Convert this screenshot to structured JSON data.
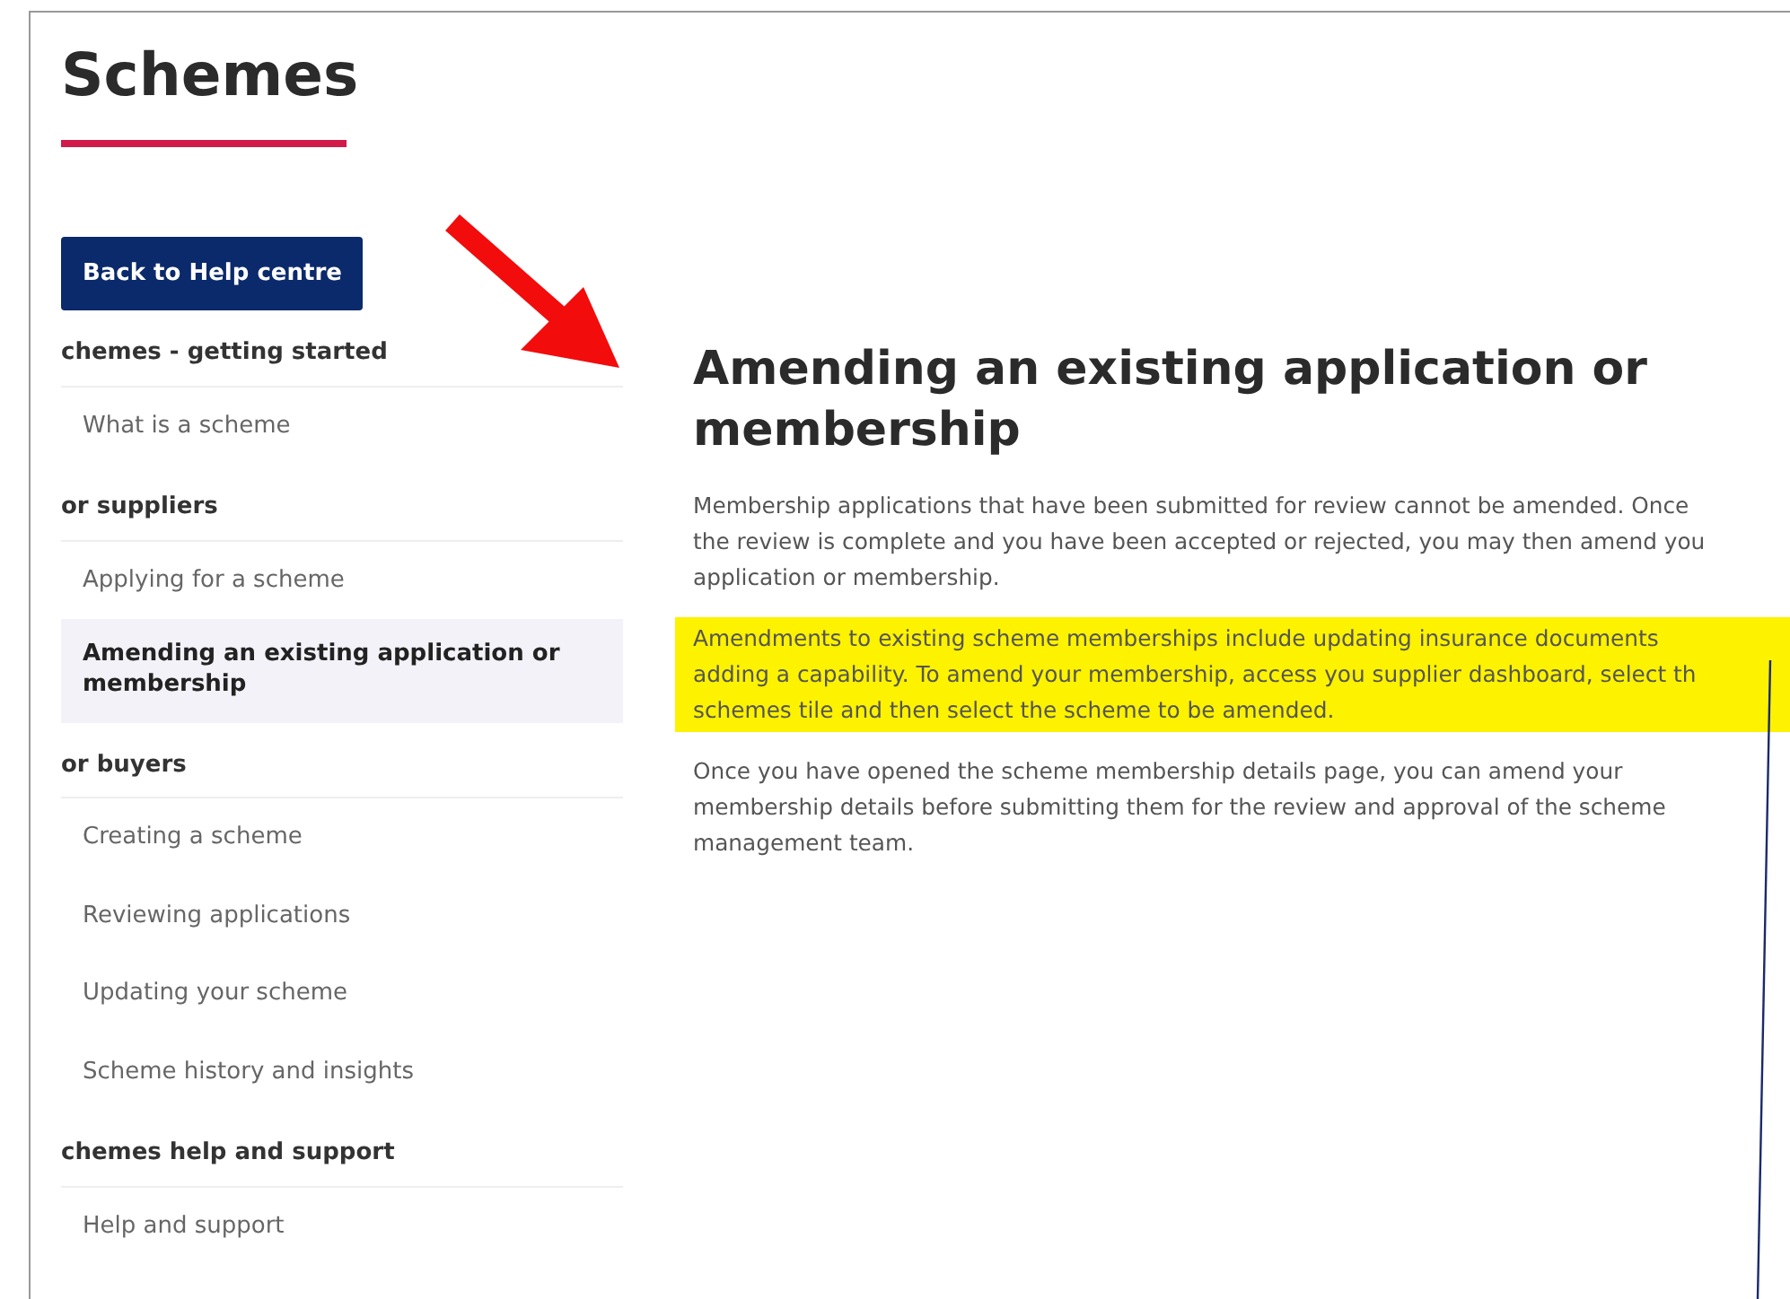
{
  "page_title": "Schemes",
  "back_button": "Back to Help centre",
  "sidebar": [
    {
      "heading": "chemes - getting started",
      "items": [
        {
          "label": "What is a scheme",
          "selected": false
        }
      ]
    },
    {
      "heading": "or suppliers",
      "items": [
        {
          "label": "Applying for a scheme",
          "selected": false
        },
        {
          "label": "Amending an existing application or membership",
          "selected": true
        }
      ]
    },
    {
      "heading": "or buyers",
      "items": [
        {
          "label": "Creating a scheme",
          "selected": false
        },
        {
          "label": "Reviewing applications",
          "selected": false
        },
        {
          "label": "Updating your scheme",
          "selected": false
        },
        {
          "label": "Scheme history and insights",
          "selected": false
        }
      ]
    },
    {
      "heading": "chemes help and support",
      "items": [
        {
          "label": "Help and support",
          "selected": false
        }
      ]
    }
  ],
  "article": {
    "title": "Amending an existing application or membership",
    "paragraphs": [
      {
        "highlighted": false,
        "lines": [
          "Membership applications that have been submitted for review cannot be amended. Once",
          "the review is complete and you have been accepted or rejected, you may then amend you",
          "application or membership."
        ]
      },
      {
        "highlighted": true,
        "lines": [
          "Amendments to existing scheme memberships include updating insurance documents",
          "adding a capability. To amend your membership, access you supplier dashboard, select th",
          "schemes tile and then select the scheme to be amended."
        ]
      },
      {
        "highlighted": false,
        "lines": [
          "Once you have opened the scheme membership details page, you can amend your",
          "membership details before submitting them for the review and approval of the scheme",
          "management team."
        ]
      }
    ]
  }
}
